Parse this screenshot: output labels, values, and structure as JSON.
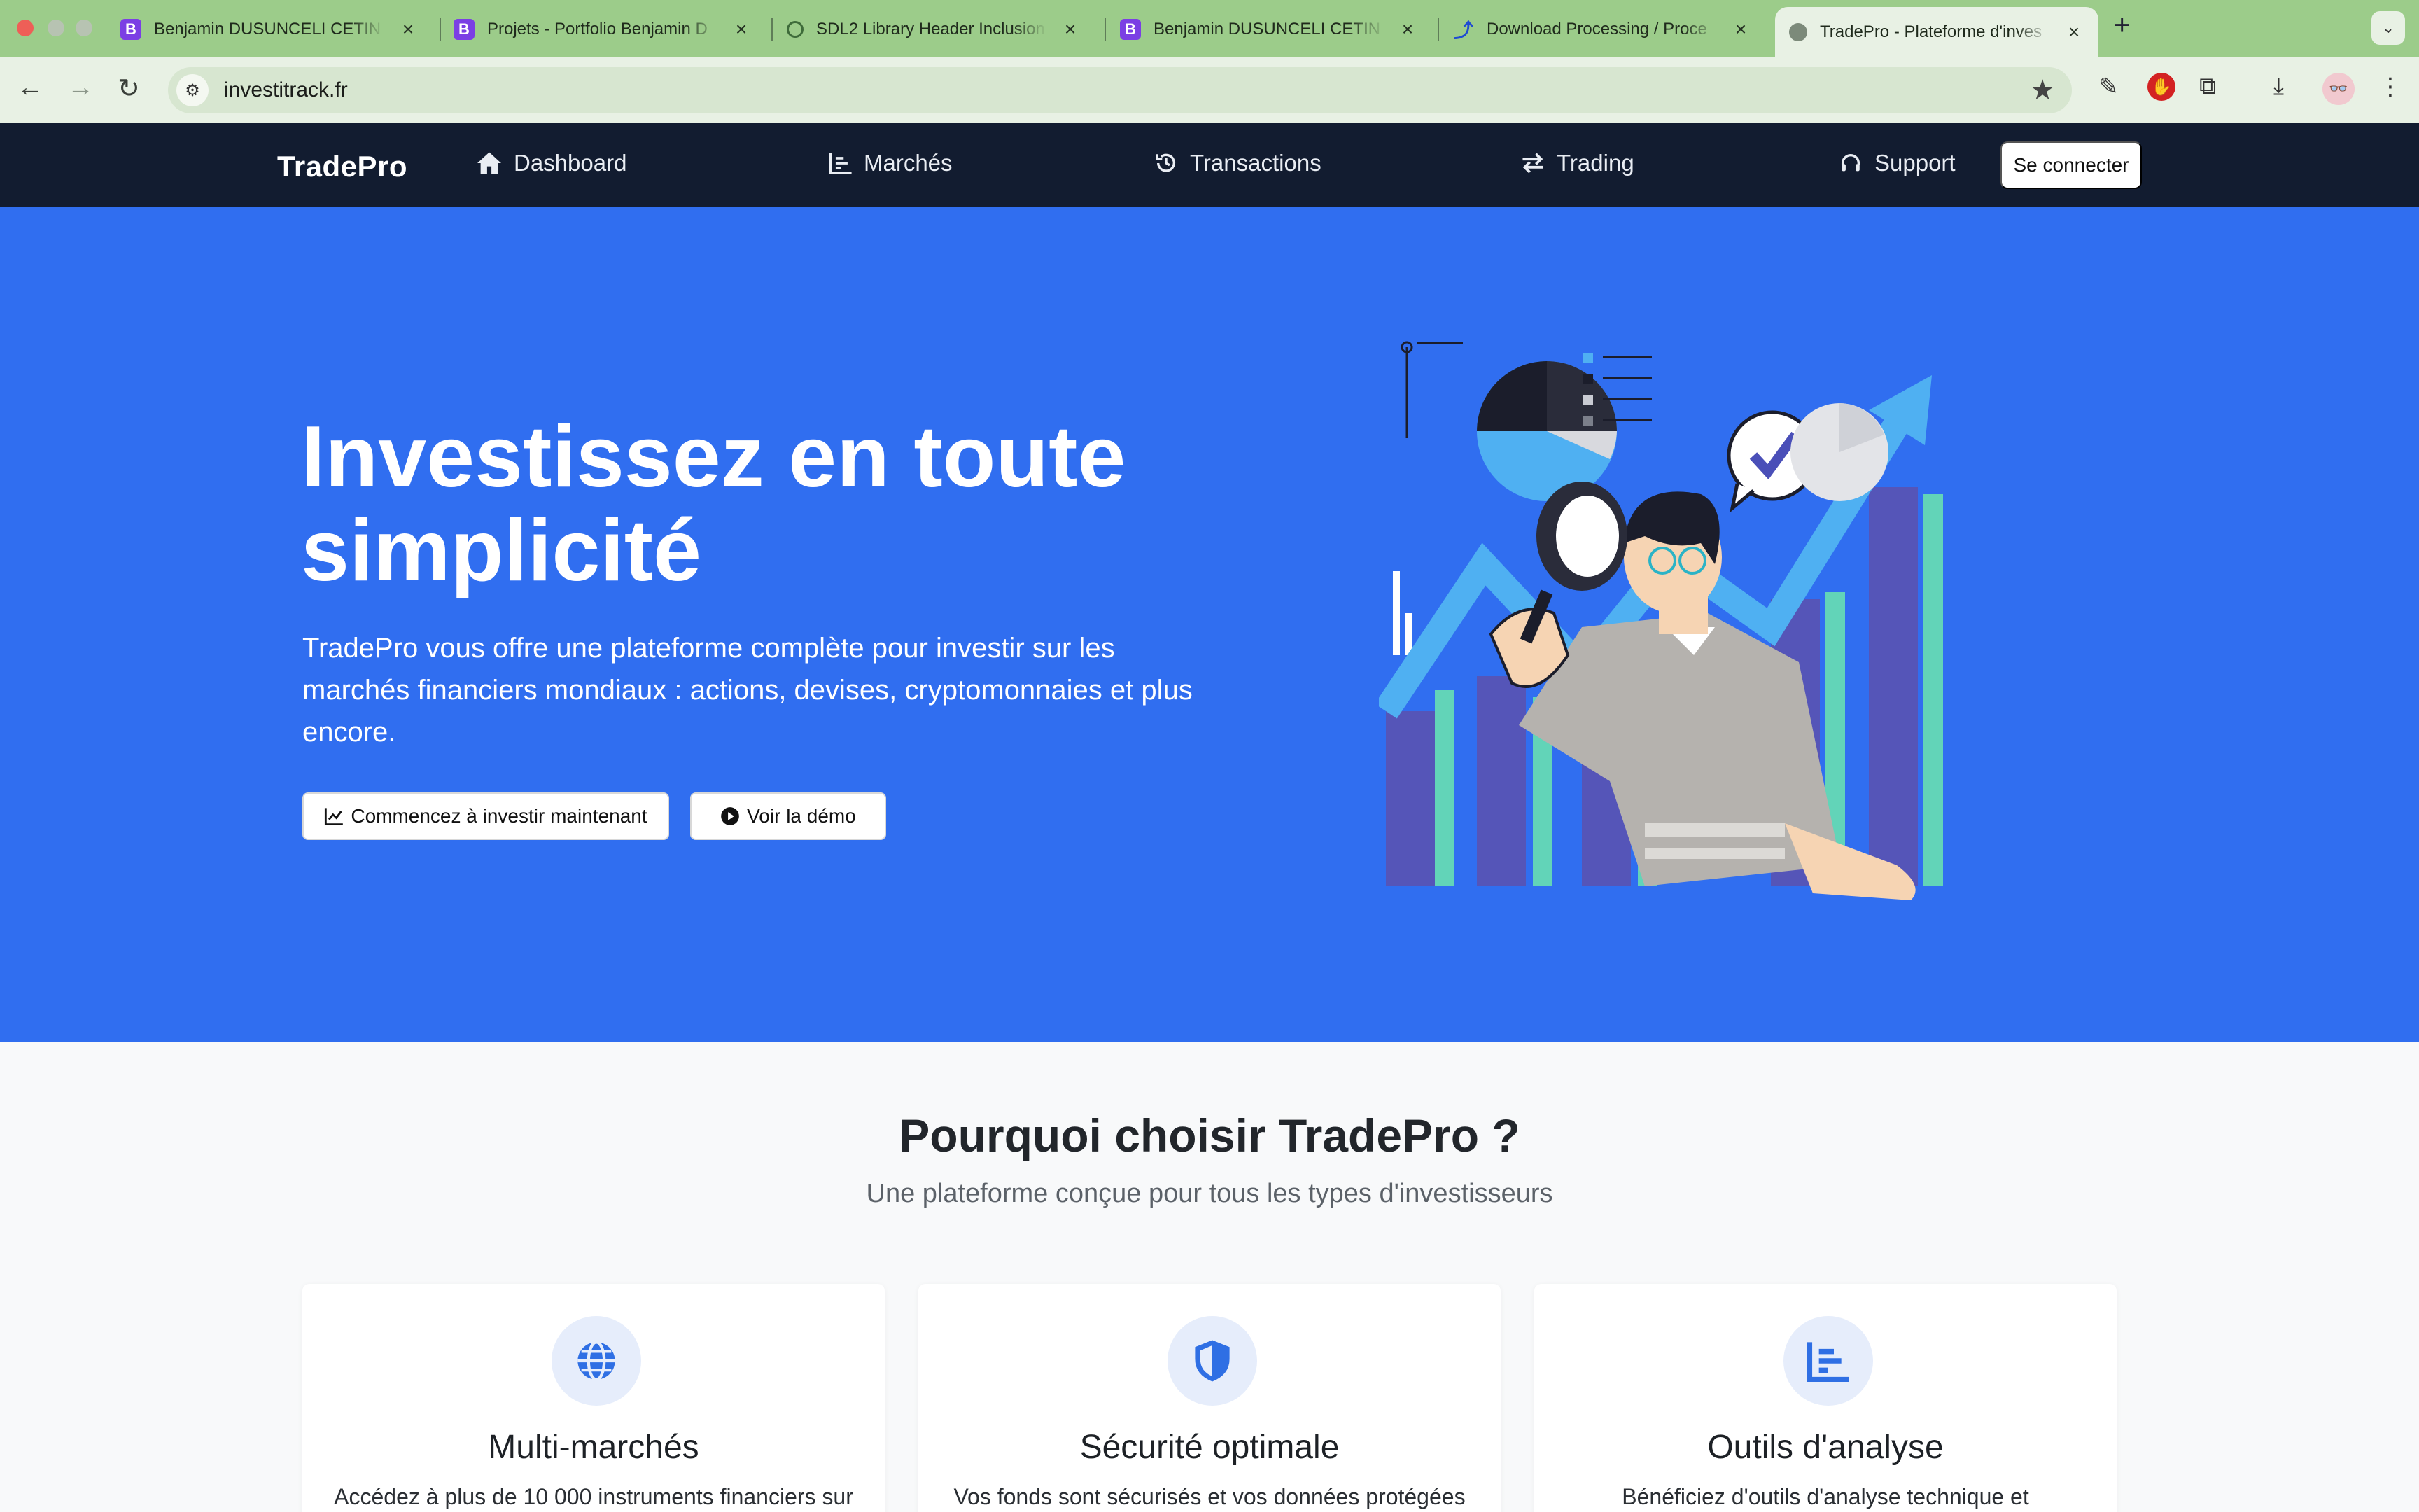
{
  "browser": {
    "tabs": [
      {
        "title": "Benjamin DUSUNCELI CETIN",
        "icon": "bootstrap-icon"
      },
      {
        "title": "Projets - Portfolio Benjamin D",
        "icon": "bootstrap-icon"
      },
      {
        "title": "SDL2 Library Header Inclusion",
        "icon": "openai-icon"
      },
      {
        "title": "Benjamin DUSUNCELI CETIN",
        "icon": "bootstrap-icon"
      },
      {
        "title": "Download Processing / Proce",
        "icon": "processing-icon"
      },
      {
        "title": "TradePro - Plateforme d'inves",
        "icon": "globe-icon"
      }
    ],
    "active_tab_index": 5,
    "favicon_letter": "B",
    "url": "investitrack.fr"
  },
  "nav": {
    "brand": "TradePro",
    "links": [
      {
        "label": "Dashboard",
        "icon": "home-icon"
      },
      {
        "label": "Marchés",
        "icon": "chart-icon"
      },
      {
        "label": "Transactions",
        "icon": "history-icon"
      },
      {
        "label": "Trading",
        "icon": "exchange-icon"
      },
      {
        "label": "Support",
        "icon": "headset-icon"
      }
    ],
    "login_label": "Se connecter"
  },
  "hero": {
    "title": "Investissez en toute simplicité",
    "subtitle": "TradePro vous offre une plateforme complète pour investir sur les marchés financiers mondiaux : actions, devises, cryptomonnaies et plus encore.",
    "cta_primary": "Commencez à investir maintenant",
    "cta_secondary": "Voir la démo"
  },
  "features": {
    "title": "Pourquoi choisir TradePro ?",
    "subtitle": "Une plateforme conçue pour tous les types d'investisseurs",
    "cards": [
      {
        "title": "Multi-marchés",
        "desc": "Accédez à plus de 10 000 instruments financiers sur",
        "icon": "globe-icon"
      },
      {
        "title": "Sécurité optimale",
        "desc": "Vos fonds sont sécurisés et vos données protégées",
        "icon": "shield-icon"
      },
      {
        "title": "Outils d'analyse",
        "desc": "Bénéficiez d'outils d'analyse technique et",
        "icon": "chart-icon"
      }
    ]
  },
  "colors": {
    "hero_bg": "#306ef0",
    "navbar_bg": "#121c30",
    "tabstrip_bg": "#9ccc8a",
    "accent": "#2f6fe4"
  }
}
